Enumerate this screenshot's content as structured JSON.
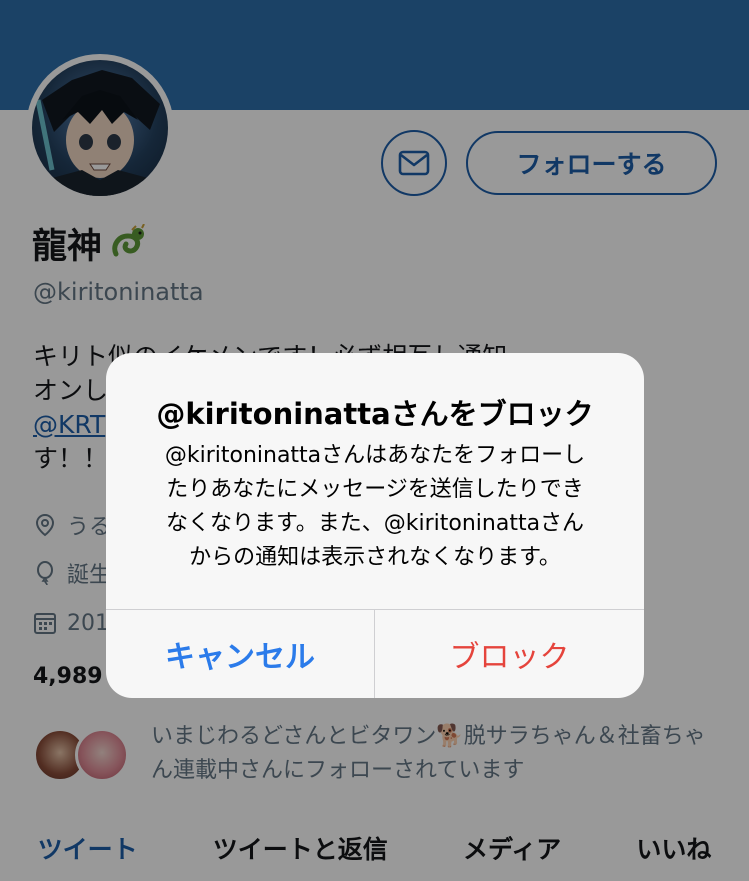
{
  "profile": {
    "display_name": "龍神",
    "handle": "@kiritoninatta",
    "bio_lines": [
      "キリト似のイケメンです！必ず相互し通知",
      "オンし",
      "@KRT",
      "す！！"
    ],
    "location": "うる",
    "birthday": "誕生",
    "joined": "201",
    "follow_counts": "4,989",
    "known_followers": "いまじわるどさんとビタワン🐕脱サラちゃん＆社畜ちゃん連載中さんにフォローされています"
  },
  "buttons": {
    "follow_label": "フォローする"
  },
  "tabs": [
    {
      "label": "ツイート"
    },
    {
      "label": "ツイートと返信"
    },
    {
      "label": "メディア"
    },
    {
      "label": "いいね"
    }
  ],
  "alert": {
    "title": "@kiritoninattaさんをブロック",
    "message_lines": [
      "@kiritoninattaさんはあなたをフォローし",
      "たりあなたにメッセージを送信したりでき",
      "なくなります。また、@kiritoninattaさん",
      "からの通知は表示されなくなります。"
    ],
    "cancel_label": "キャンセル",
    "block_label": "ブロック"
  },
  "icons": {
    "message": "envelope-icon",
    "location": "location-pin-icon",
    "birthday": "balloon-icon",
    "joined": "calendar-icon",
    "dragon": "dragon-emoji-icon"
  },
  "colors": {
    "banner": "#2e6fab",
    "accent": "#1d5ea8",
    "cancel": "#2b7bea",
    "block": "#e5443c"
  }
}
